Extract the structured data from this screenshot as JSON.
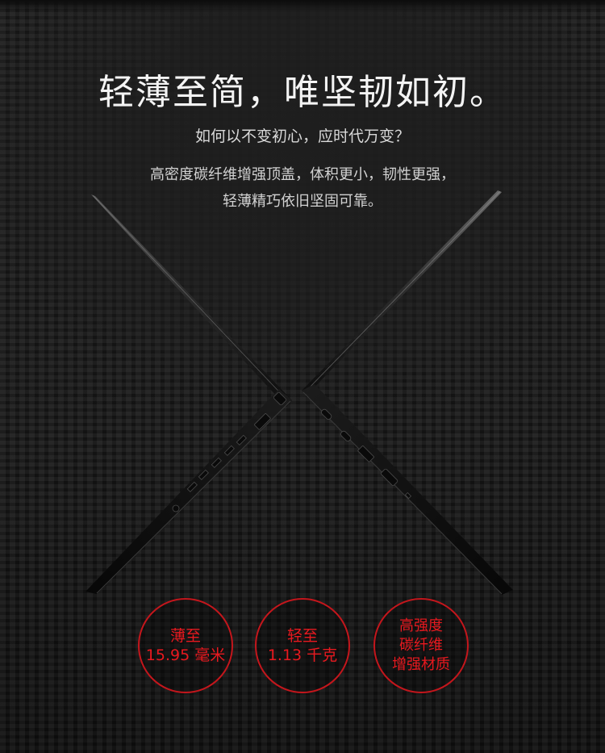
{
  "headline": "轻薄至简，唯坚韧如初。",
  "subtitle": "如何以不变初心，应时代万变？",
  "description": {
    "line1": "高密度碳纤维增强顶盖，体积更小，韧性更强，",
    "line2": "轻薄精巧依旧坚固可靠。"
  },
  "badges": [
    {
      "line1": "薄至",
      "line2": "15.95 毫米"
    },
    {
      "line1": "轻至",
      "line2": "1.13 千克"
    },
    {
      "line1": "高强度",
      "line2": "碳纤维",
      "line3": "增强材质"
    }
  ],
  "colors": {
    "background": "#1b1b1b",
    "headline": "#f4f4f4",
    "badge_accent": "#c4161c"
  }
}
